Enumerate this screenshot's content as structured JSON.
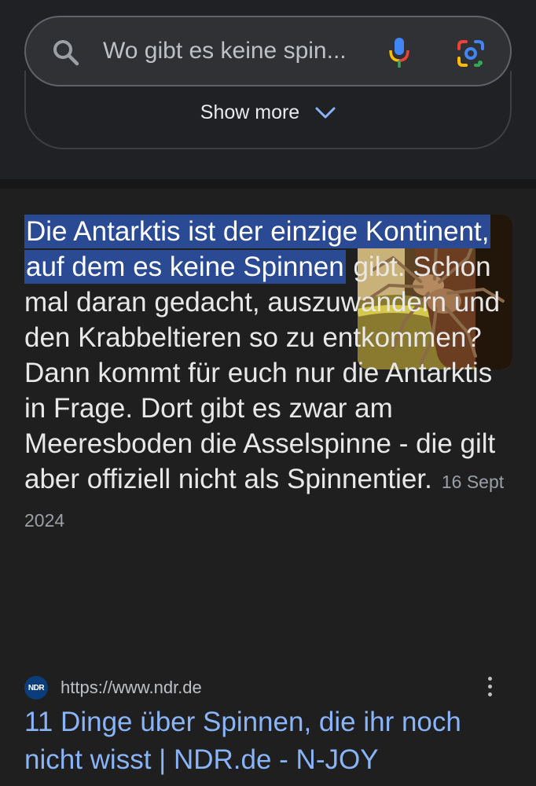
{
  "search": {
    "query": "Wo gibt es keine spin...",
    "icons": {
      "search": "search-icon",
      "mic": "mic-icon",
      "lens": "google-lens-icon"
    }
  },
  "show_more": {
    "label": "Show more",
    "icon": "chevron-down-icon"
  },
  "snippet": {
    "highlight": "Die Antarktis ist der einzige Kontinent, auf dem es keine Spinnen",
    "body": " gibt. Schon mal daran gedacht, auszuwandern und den Krabbeltieren so zu entkommen? Dann kommt für euch nur die Antarktis in Frage. Dort gibt es zwar am Meeresboden die Asselspinne - die gilt aber offiziell nicht als Spinnentier.",
    "date": "16 Sept 2024",
    "image": "spider-photo"
  },
  "source": {
    "favicon_text": "NDR",
    "url": "https://www.ndr.de",
    "menu_icon": "more-vert-icon"
  },
  "result": {
    "title": "11 Dinge über Spinnen, die ihr noch nicht wisst | NDR.de - N-JOY"
  },
  "colors": {
    "background": "#1f1f1f",
    "highlight": "#2b4a94",
    "link": "#8ab4f8",
    "search_bar": "#303134"
  }
}
